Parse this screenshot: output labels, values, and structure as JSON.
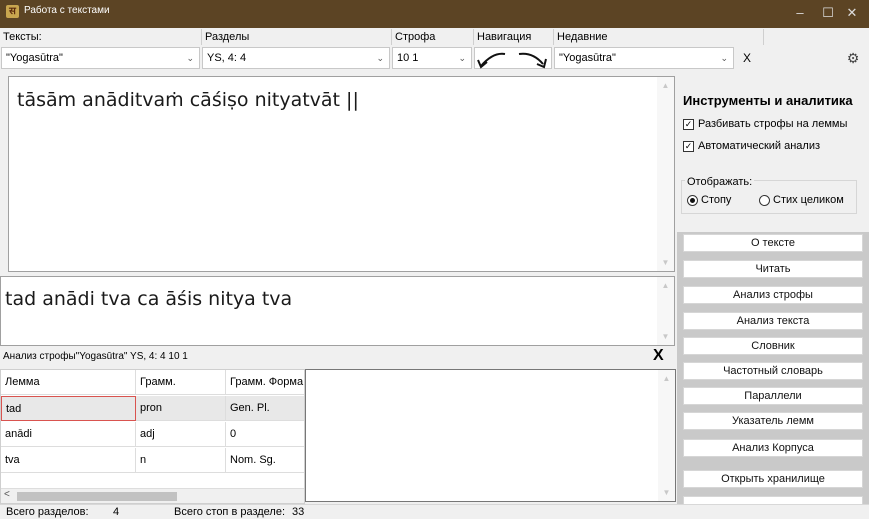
{
  "window": {
    "title": "Работа с текстами",
    "app_icon_glyph": "स",
    "controls": [
      "–",
      "☐",
      "✕"
    ]
  },
  "header": {
    "texts_label": "Тексты:",
    "sections_label": "Разделы",
    "stanza_label": "Строфа",
    "navigation_label": "Навигация",
    "recent_label": "Недавние"
  },
  "combos": {
    "texts_value": "\"Yogasūtra\"",
    "sections_value": "YS, 4: 4",
    "stanza_value": "10 1",
    "recent_value": "\"Yogasūtra\"",
    "recent_clear": "X"
  },
  "editor": {
    "verse_text": "tāsām anāditvaṁ cāśiṣo nityatvāt ||",
    "split_text": "tad anādi tva ca āśis nitya tva"
  },
  "analysis": {
    "caption": "Анализ строфы\"Yogasūtra\" YS, 4: 4 10 1",
    "close_label": "X",
    "columns": [
      "Лемма",
      "Грамм.",
      "Грамм. Форма"
    ],
    "rows": [
      [
        "tad",
        "pron",
        "Gen. Pl."
      ],
      [
        "anādi",
        "adj",
        "0"
      ],
      [
        "tva",
        "n",
        "Nom. Sg."
      ]
    ]
  },
  "tools": {
    "heading": "Инструменты и аналитика",
    "split_lemmas_label": "Разбивать строфы на леммы",
    "split_lemmas_checked": true,
    "auto_analysis_label": "Автоматический анализ",
    "auto_analysis_checked": true,
    "display_label": "Отображать:",
    "display_foot_label": "Стопу",
    "display_whole_label": "Стих целиком",
    "display_selected": "foot"
  },
  "buttons": [
    "О тексте",
    "Читать",
    "Анализ строфы",
    "Анализ текста",
    "Словник",
    "Частотный словарь",
    "Параллели",
    "Указатель лемм",
    "Анализ Корпуса",
    "Открыть хранилище"
  ],
  "status": {
    "sections_label": "Всего разделов:",
    "sections_value": "4",
    "feet_label": "Всего стоп в разделе:",
    "feet_value": "33"
  },
  "colors": {
    "titlebar": "#5c4424",
    "right_panel": "#c9c9c9",
    "selection_border": "#d9534f"
  }
}
